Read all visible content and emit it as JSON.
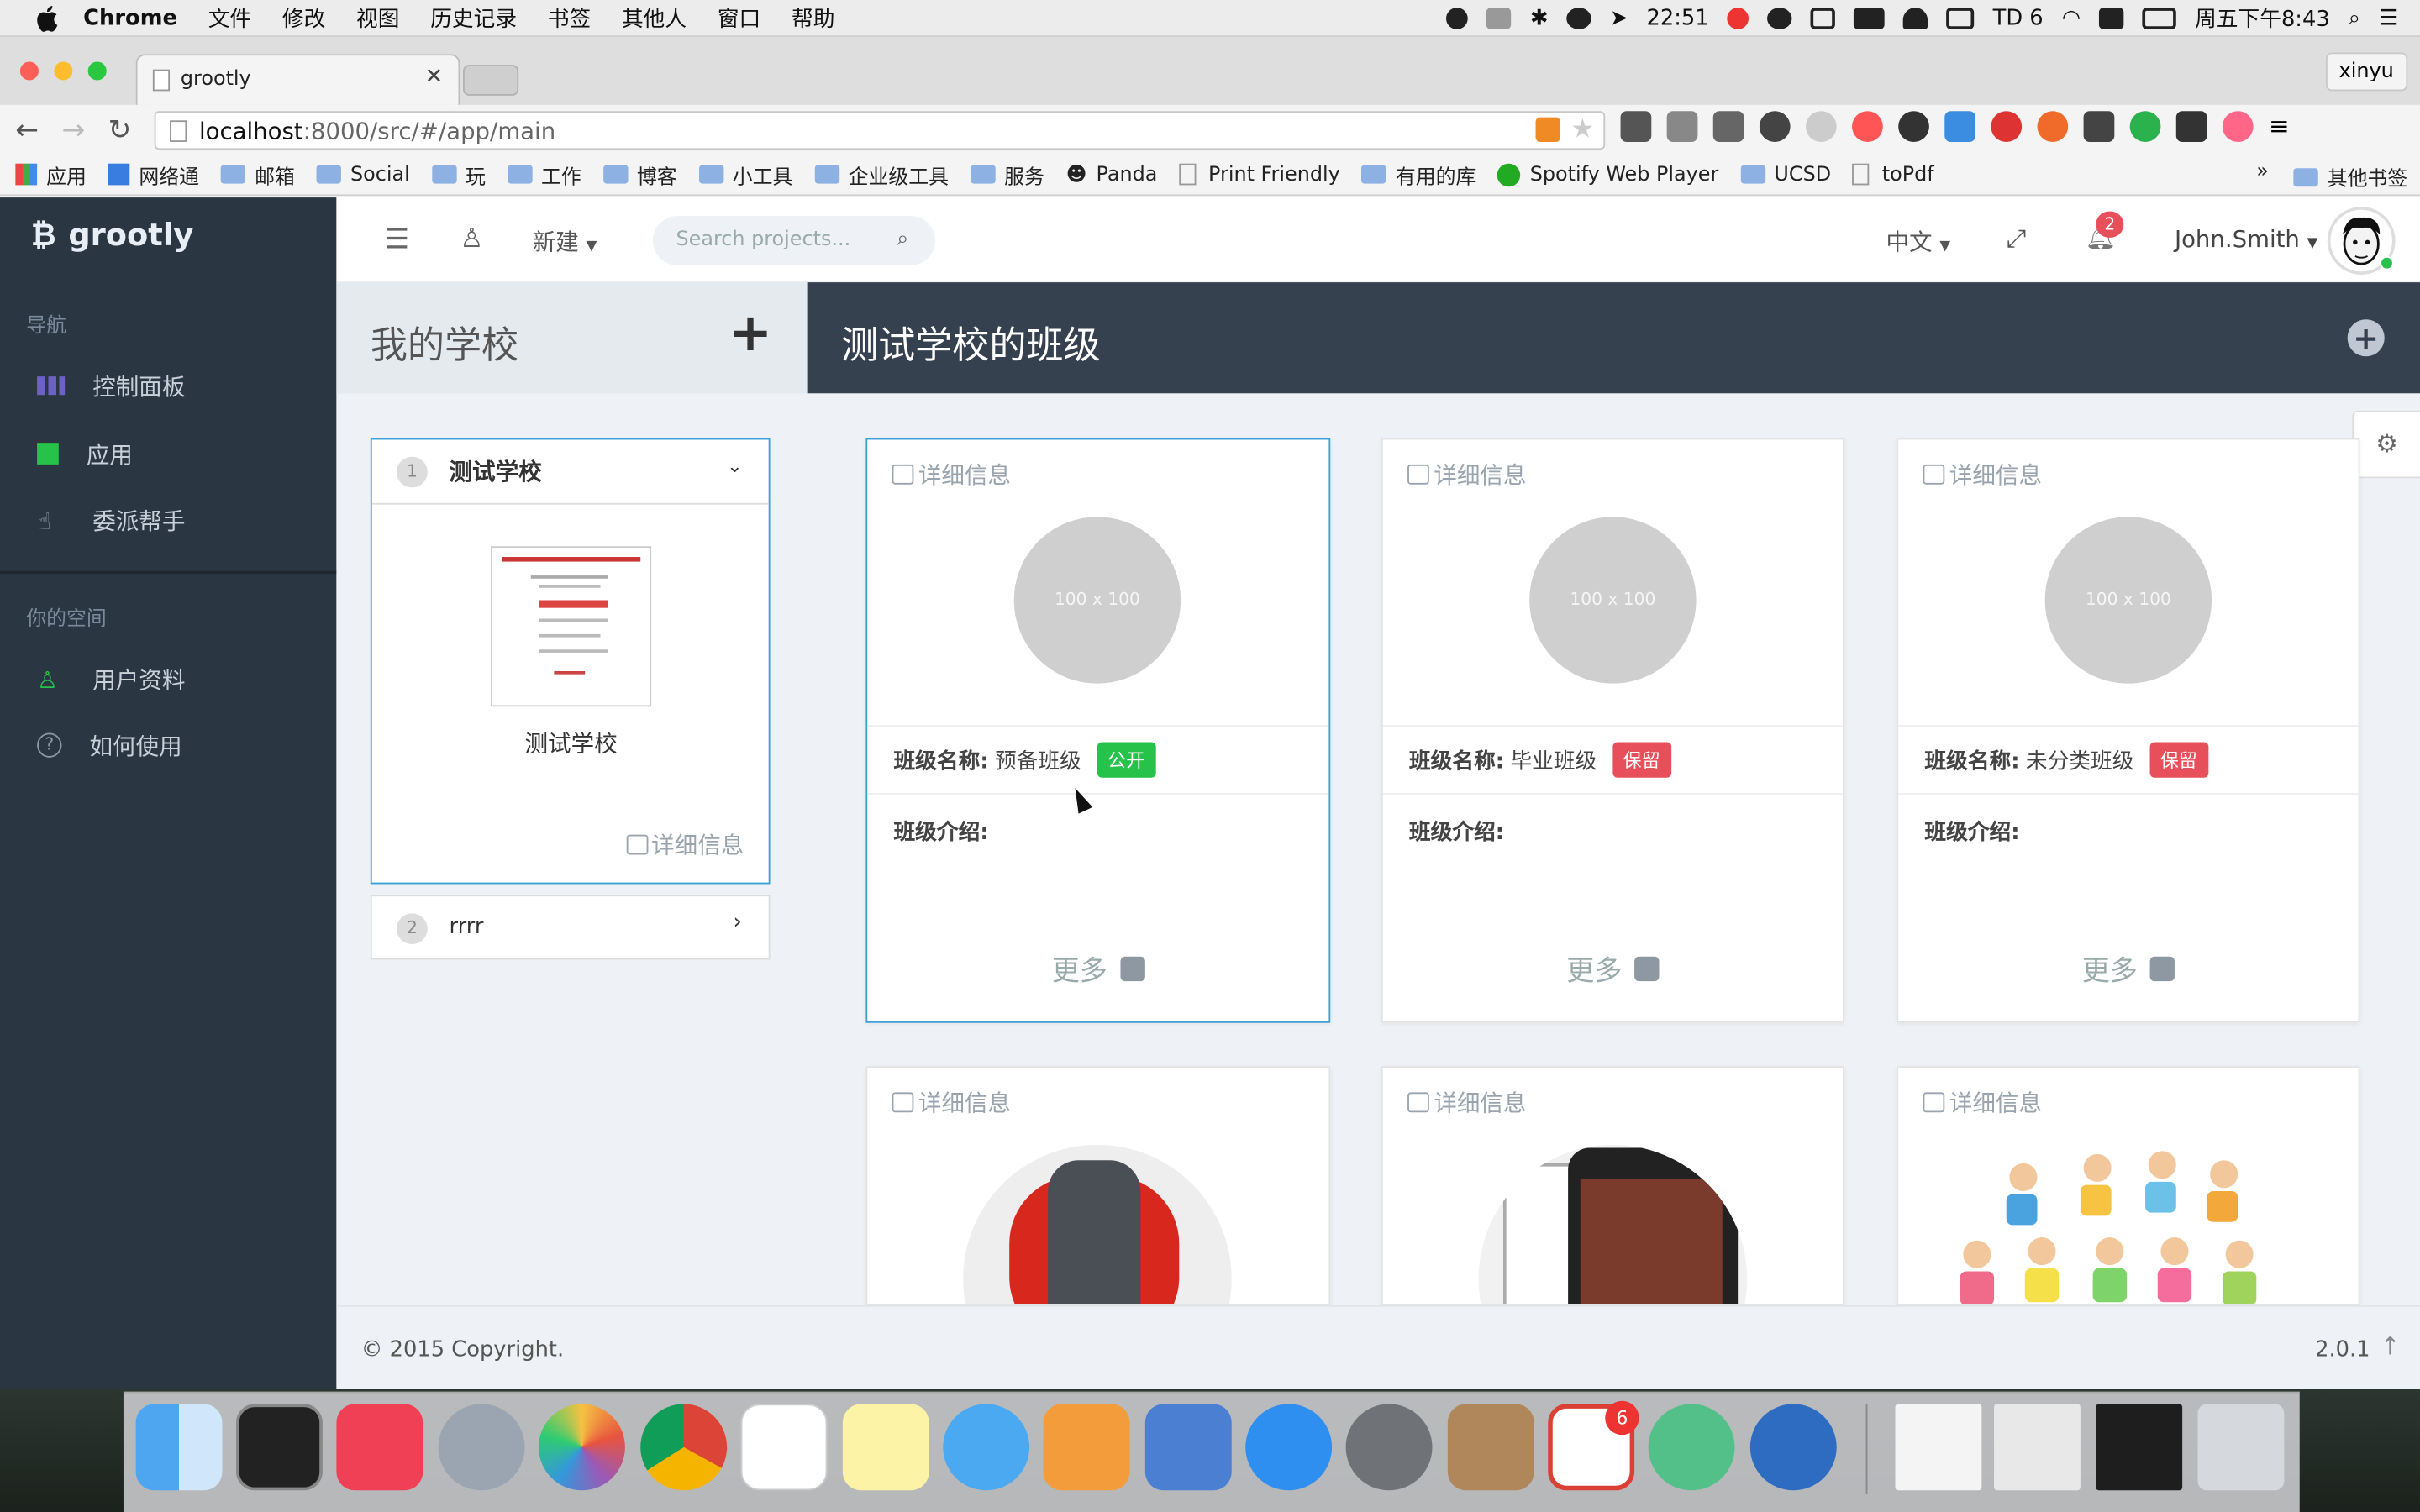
{
  "menubar": {
    "app": "Chrome",
    "items": [
      "文件",
      "修改",
      "视图",
      "历史记录",
      "书签",
      "其他人",
      "窗口",
      "帮助"
    ],
    "time": "22:51",
    "td": "TD 6",
    "clock": "周五下午8:43"
  },
  "browser": {
    "tab_title": "grootly",
    "profile": "xinyu",
    "url_host": "localhost",
    "url_path": ":8000/src/#/app/main"
  },
  "bookmarks": [
    "应用",
    "网络通",
    "邮箱",
    "Social",
    "玩",
    "工作",
    "博客",
    "小工具",
    "企业级工具",
    "服务",
    "Panda",
    "Print Friendly",
    "有用的库",
    "Spotify Web Player",
    "UCSD",
    "toPdf"
  ],
  "bookmarks_more": "»",
  "bookmarks_other": "其他书签",
  "app": {
    "brand": "grootly",
    "nav_header": "导航",
    "nav": [
      "控制面板",
      "应用",
      "委派帮手"
    ],
    "space_header": "你的空间",
    "space": [
      "用户资料",
      "如何使用"
    ],
    "new_label": "新建",
    "search_placeholder": "Search projects...",
    "lang": "中文",
    "notif_count": "2",
    "user": "John.Smith",
    "left_title": "我的学校",
    "right_title": "测试学校的班级",
    "schools": [
      {
        "num": "1",
        "name": "测试学校",
        "caption": "测试学校",
        "detail": "详细信息"
      },
      {
        "num": "2",
        "name": "rrrr"
      }
    ],
    "card_detail": "详细信息",
    "class_name_label": "班级名称:",
    "class_intro_label": "班级介绍:",
    "more": "更多",
    "placeholder": "100 x 100",
    "classes": [
      {
        "name": "预备班级",
        "badge": "公开",
        "badge_color": "#26c24a"
      },
      {
        "name": "毕业班级",
        "badge": "保留",
        "badge_color": "#e7505a"
      },
      {
        "name": "未分类班级",
        "badge": "保留",
        "badge_color": "#e7505a"
      }
    ],
    "footer": "© 2015 Copyright.",
    "version": "2.0.1"
  }
}
